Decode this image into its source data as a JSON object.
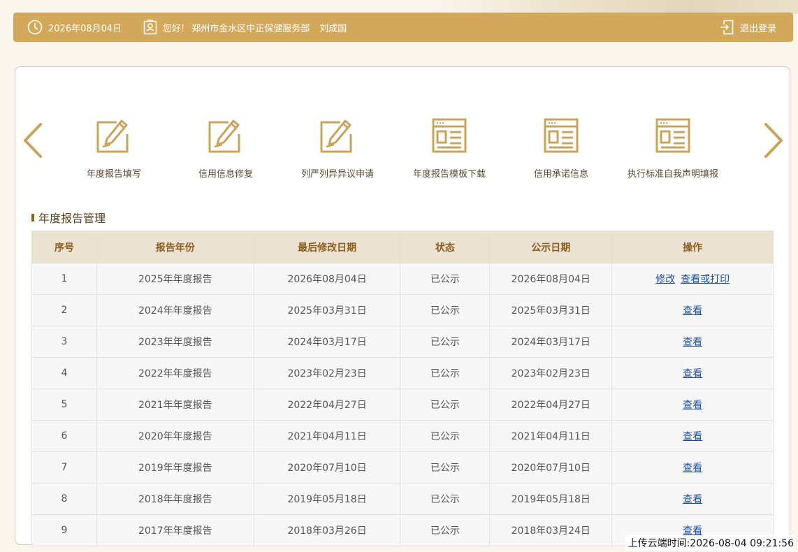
{
  "colors": {
    "header_bg": "#d2a95a",
    "icon_gold": "#c9a45c",
    "table_head_bg": "#ebe2d1",
    "table_head_text": "#8b5e1e",
    "link": "#1f4f9c"
  },
  "header": {
    "date": "2026年08月04日",
    "greeting": "您好!",
    "company": "郑州市金水区中正保健服务部",
    "person": "刘成国",
    "logout_label": "退出登录"
  },
  "shortcuts": [
    {
      "label": "年度报告填写",
      "icon": "edit-icon"
    },
    {
      "label": "信用信息修复",
      "icon": "edit-icon"
    },
    {
      "label": "列严列异异议申请",
      "icon": "edit-icon"
    },
    {
      "label": "年度报告模板下载",
      "icon": "document-template-icon"
    },
    {
      "label": "信用承诺信息",
      "icon": "document-template-icon"
    },
    {
      "label": "执行标准自我声明填报",
      "icon": "document-template-icon"
    }
  ],
  "section": {
    "title": "年度报告管理"
  },
  "table": {
    "headers": [
      "序号",
      "报告年份",
      "最后修改日期",
      "状态",
      "公示日期",
      "操作"
    ],
    "rows": [
      {
        "no": "1",
        "year": "2025年年度报告",
        "modified": "2026年08月04日",
        "status": "已公示",
        "published": "2026年08月04日",
        "actions": [
          "修改",
          "查看或打印"
        ]
      },
      {
        "no": "2",
        "year": "2024年年度报告",
        "modified": "2025年03月31日",
        "status": "已公示",
        "published": "2025年03月31日",
        "actions": [
          "查看"
        ]
      },
      {
        "no": "3",
        "year": "2023年年度报告",
        "modified": "2024年03月17日",
        "status": "已公示",
        "published": "2024年03月17日",
        "actions": [
          "查看"
        ]
      },
      {
        "no": "4",
        "year": "2022年年度报告",
        "modified": "2023年02月23日",
        "status": "已公示",
        "published": "2023年02月23日",
        "actions": [
          "查看"
        ]
      },
      {
        "no": "5",
        "year": "2021年年度报告",
        "modified": "2022年04月27日",
        "status": "已公示",
        "published": "2022年04月27日",
        "actions": [
          "查看"
        ]
      },
      {
        "no": "6",
        "year": "2020年年度报告",
        "modified": "2021年04月11日",
        "status": "已公示",
        "published": "2021年04月11日",
        "actions": [
          "查看"
        ]
      },
      {
        "no": "7",
        "year": "2019年年度报告",
        "modified": "2020年07月10日",
        "status": "已公示",
        "published": "2020年07月10日",
        "actions": [
          "查看"
        ]
      },
      {
        "no": "8",
        "year": "2018年年度报告",
        "modified": "2019年05月18日",
        "status": "已公示",
        "published": "2019年05月18日",
        "actions": [
          "查看"
        ]
      },
      {
        "no": "9",
        "year": "2017年年度报告",
        "modified": "2018年03月26日",
        "status": "已公示",
        "published": "2018年03月24日",
        "actions": [
          "查看"
        ]
      }
    ]
  },
  "footer": {
    "upload_time": "上传云端时间:2026-08-04 09:21:56"
  }
}
